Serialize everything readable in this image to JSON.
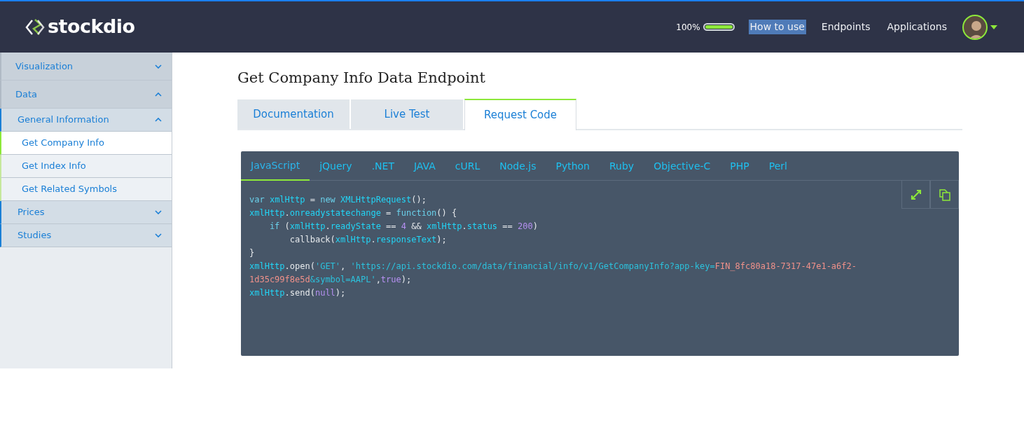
{
  "brand": {
    "name": "stockdio"
  },
  "header": {
    "battery_reading": "100%",
    "battery": {
      "level": 1
    },
    "links": [
      {
        "label": "How to use",
        "selected": true
      },
      {
        "label": "Endpoints",
        "selected": false
      },
      {
        "label": "Applications",
        "selected": false
      }
    ]
  },
  "sidebar": {
    "items": [
      {
        "label": "Visualization",
        "expanded": false
      },
      {
        "label": "Data",
        "expanded": true,
        "children": [
          {
            "label": "General Information",
            "expanded": true,
            "children": [
              {
                "label": "Get Company Info",
                "selected": true
              },
              {
                "label": "Get Index Info",
                "selected": false
              },
              {
                "label": "Get Related Symbols",
                "selected": false
              }
            ]
          }
        ]
      },
      {
        "label": "Prices",
        "expanded": false
      },
      {
        "label": "Studies",
        "expanded": false
      }
    ]
  },
  "page": {
    "title": "Get Company Info Data Endpoint",
    "tabs": [
      {
        "label": "Documentation",
        "selected": false
      },
      {
        "label": "Live Test",
        "selected": false
      },
      {
        "label": "Request Code",
        "selected": true
      }
    ],
    "code_tabs": [
      {
        "label": "JavaScript",
        "selected": true
      },
      {
        "label": "jQuery",
        "selected": false
      },
      {
        "label": ".NET",
        "selected": false
      },
      {
        "label": "JAVA",
        "selected": false
      },
      {
        "label": "cURL",
        "selected": false
      },
      {
        "label": "Node.js",
        "selected": false
      },
      {
        "label": "Python",
        "selected": false
      },
      {
        "label": "Ruby",
        "selected": false
      },
      {
        "label": "Objective-C",
        "selected": false
      },
      {
        "label": "PHP",
        "selected": false
      },
      {
        "label": "Perl",
        "selected": false
      }
    ],
    "code_lines": [
      [
        {
          "kind": "keyword",
          "text": "var "
        },
        {
          "kind": "ident",
          "text": "xmlHttp"
        },
        {
          "kind": "plain",
          "text": " = "
        },
        {
          "kind": "keyword",
          "text": "new "
        },
        {
          "kind": "ident",
          "text": "XMLHttpRequest"
        },
        {
          "kind": "plain",
          "text": "();"
        }
      ],
      [
        {
          "kind": "ident",
          "text": "xmlHttp"
        },
        {
          "kind": "plain",
          "text": "."
        },
        {
          "kind": "ident",
          "text": "onreadystatechange"
        },
        {
          "kind": "plain",
          "text": " = "
        },
        {
          "kind": "keyword",
          "text": "function"
        },
        {
          "kind": "plain",
          "text": "() {"
        }
      ],
      [
        {
          "kind": "keyword",
          "text": "    if"
        },
        {
          "kind": "plain",
          "text": " ("
        },
        {
          "kind": "ident",
          "text": "xmlHttp"
        },
        {
          "kind": "plain",
          "text": "."
        },
        {
          "kind": "ident",
          "text": "readyState"
        },
        {
          "kind": "plain",
          "text": " == "
        },
        {
          "kind": "number",
          "text": "4"
        },
        {
          "kind": "plain",
          "text": " && "
        },
        {
          "kind": "ident",
          "text": "xmlHttp"
        },
        {
          "kind": "plain",
          "text": "."
        },
        {
          "kind": "ident",
          "text": "status"
        },
        {
          "kind": "plain",
          "text": " == "
        },
        {
          "kind": "number",
          "text": "200"
        },
        {
          "kind": "plain",
          "text": ")"
        }
      ],
      [
        {
          "kind": "plain",
          "text": "        callback("
        },
        {
          "kind": "ident",
          "text": "xmlHttp"
        },
        {
          "kind": "plain",
          "text": "."
        },
        {
          "kind": "ident",
          "text": "responseText"
        },
        {
          "kind": "plain",
          "text": ");"
        }
      ],
      [
        {
          "kind": "plain",
          "text": "}"
        }
      ],
      [
        {
          "kind": "ident",
          "text": "xmlHttp"
        },
        {
          "kind": "plain",
          "text": ".open("
        },
        {
          "kind": "string",
          "text": "'GET'"
        },
        {
          "kind": "plain",
          "text": ", "
        },
        {
          "kind": "string",
          "text": "'https://api.stockdio.com/data/financial/info/v1/GetCompanyInfo?app-key="
        },
        {
          "kind": "key",
          "text": "FIN_8fc80a18-7317-47e1-a6f2-"
        }
      ],
      [
        {
          "kind": "key",
          "text": "1d35c99f8e5d"
        },
        {
          "kind": "string",
          "text": "&symbol=AAPL'"
        },
        {
          "kind": "plain",
          "text": ","
        },
        {
          "kind": "number",
          "text": "true"
        },
        {
          "kind": "plain",
          "text": ");"
        }
      ],
      [
        {
          "kind": "ident",
          "text": "xmlHttp"
        },
        {
          "kind": "plain",
          "text": ".send("
        },
        {
          "kind": "number",
          "text": "null"
        },
        {
          "kind": "plain",
          "text": ");"
        }
      ]
    ]
  }
}
